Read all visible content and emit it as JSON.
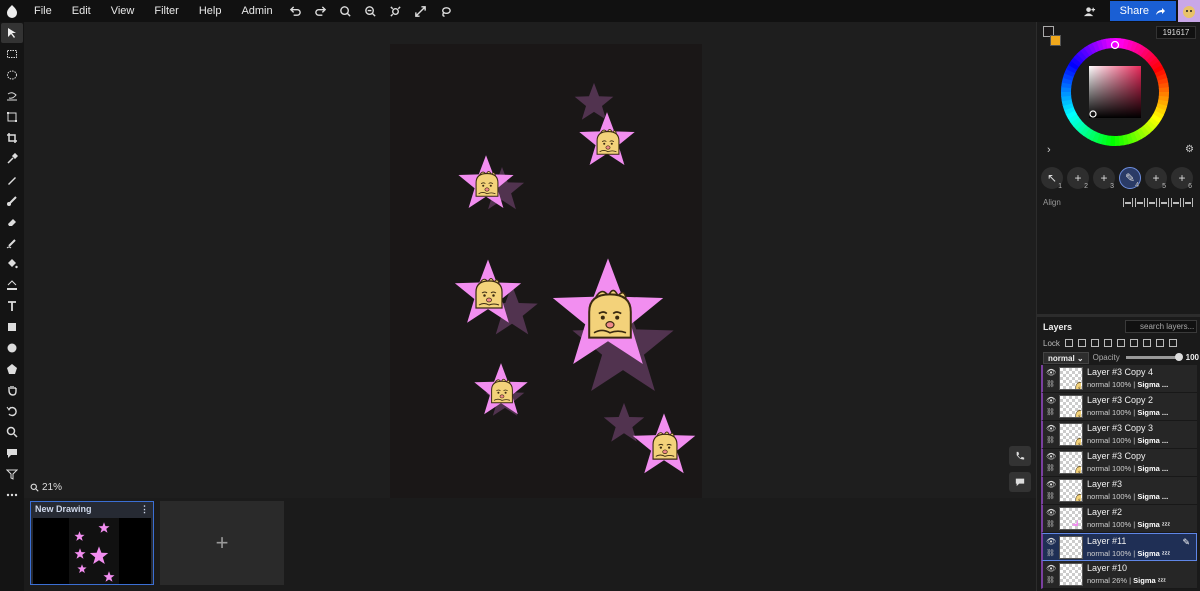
{
  "menu": [
    "File",
    "Edit",
    "View",
    "Filter",
    "Help",
    "Admin"
  ],
  "toolbar_icons": [
    "undo-icon",
    "redo-icon",
    "zoom-in-icon",
    "zoom-out-icon",
    "fit-icon",
    "fullscreen-icon",
    "lasso-icon"
  ],
  "share": {
    "label": "Share"
  },
  "tools": [
    "move",
    "rect-select",
    "ellipse-select",
    "lasso",
    "transform",
    "crop",
    "eyedropper",
    "pen",
    "brush",
    "eraser",
    "smudge",
    "bucket",
    "gradient",
    "text",
    "rectangle",
    "ellipse",
    "shape",
    "hand",
    "rotate",
    "zoom",
    "comment",
    "filter",
    "more"
  ],
  "canvas": {
    "zoom": "21%"
  },
  "documents": [
    {
      "title": "New Drawing",
      "menu": "⋮"
    }
  ],
  "add_document": "+",
  "color": {
    "hex": "191617",
    "fg": "#191617",
    "bg": "#f0a81c"
  },
  "presets": [
    {
      "num": "1",
      "icon": "move-icon"
    },
    {
      "num": "2",
      "icon": "plus-icon"
    },
    {
      "num": "3",
      "icon": "plus-icon"
    },
    {
      "num": "4",
      "icon": "brush-icon"
    },
    {
      "num": "5",
      "icon": "plus-icon"
    },
    {
      "num": "6",
      "icon": "plus-icon"
    }
  ],
  "align_label": "Align",
  "layers": {
    "title": "Layers",
    "search_placeholder": "search layers...",
    "lock_label": "Lock",
    "blend": "normal",
    "opacity_label": "Opacity",
    "opacity": "100",
    "items": [
      {
        "name": "Layer #3 Copy 4",
        "mode": "normal",
        "opacity": "100%",
        "owner": "Sigma ...",
        "thumb": "chick"
      },
      {
        "name": "Layer #3 Copy 2",
        "mode": "normal",
        "opacity": "100%",
        "owner": "Sigma ...",
        "thumb": "chick"
      },
      {
        "name": "Layer #3 Copy 3",
        "mode": "normal",
        "opacity": "100%",
        "owner": "Sigma ...",
        "thumb": "chick"
      },
      {
        "name": "Layer #3 Copy",
        "mode": "normal",
        "opacity": "100%",
        "owner": "Sigma ...",
        "thumb": "chick"
      },
      {
        "name": "Layer #3",
        "mode": "normal",
        "opacity": "100%",
        "owner": "Sigma ...",
        "thumb": "chick"
      },
      {
        "name": "Layer #2",
        "mode": "normal",
        "opacity": "100%",
        "owner": "Sigma ᶻᶻᶻ",
        "thumb": "star"
      },
      {
        "name": "Layer #11",
        "mode": "normal",
        "opacity": "100%",
        "owner": "Sigma ᶻᶻᶻ",
        "thumb": "empty",
        "selected": true
      },
      {
        "name": "Layer #10",
        "mode": "normal",
        "opacity": "26%",
        "owner": "Sigma ᶻᶻᶻ",
        "thumb": "empty"
      }
    ]
  }
}
